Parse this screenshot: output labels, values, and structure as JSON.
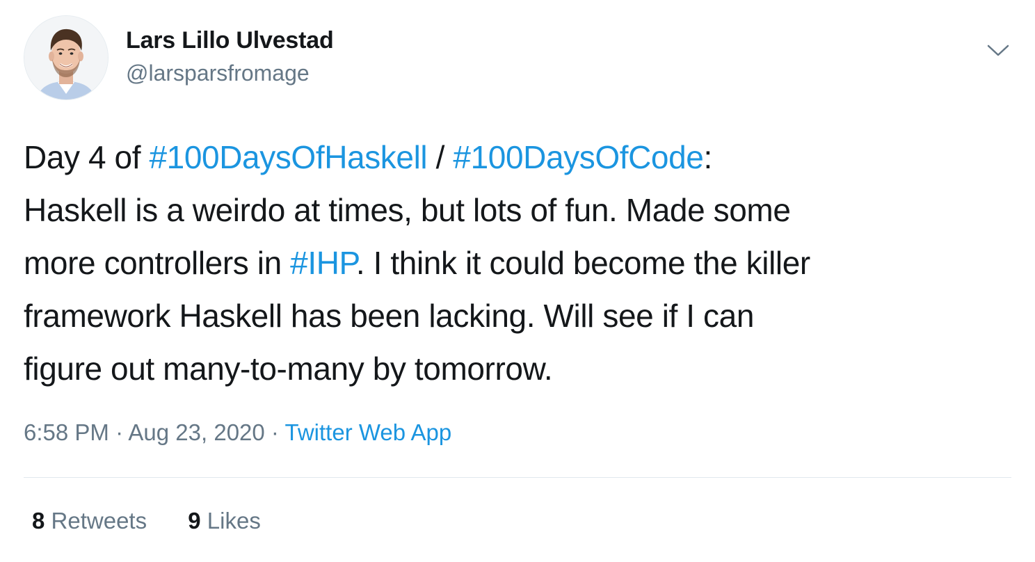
{
  "author": {
    "display_name": "Lars Lillo Ulvestad",
    "handle": "@larsparsfromage"
  },
  "tweet": {
    "lines": [
      [
        {
          "text": "Day 4 of "
        },
        {
          "text": "#100DaysOfHaskell",
          "hashtag": true
        },
        {
          "text": " / "
        },
        {
          "text": "#100DaysOfCode",
          "hashtag": true
        },
        {
          "text": ":"
        }
      ],
      [
        {
          "text": "Haskell is a weirdo at times, but lots of fun. Made some"
        }
      ],
      [
        {
          "text": "more controllers in "
        },
        {
          "text": "#IHP",
          "hashtag": true
        },
        {
          "text": ". I think it could become the killer"
        }
      ],
      [
        {
          "text": "framework Haskell has been lacking. Will see if I can"
        }
      ],
      [
        {
          "text": "figure out many-to-many by tomorrow."
        }
      ]
    ]
  },
  "meta": {
    "time": "6:58 PM",
    "separator": " · ",
    "date": "Aug 23, 2020",
    "source": "Twitter Web App"
  },
  "stats": {
    "retweets_count": "8",
    "retweets_label": "Retweets",
    "likes_count": "9",
    "likes_label": "Likes"
  },
  "colors": {
    "link": "#1b95e0",
    "secondary_text": "#657786",
    "primary_text": "#14171a",
    "divider": "#e1e8ed"
  },
  "icons": {
    "avatar": "avatar-photo",
    "menu": "chevron-down-icon"
  }
}
